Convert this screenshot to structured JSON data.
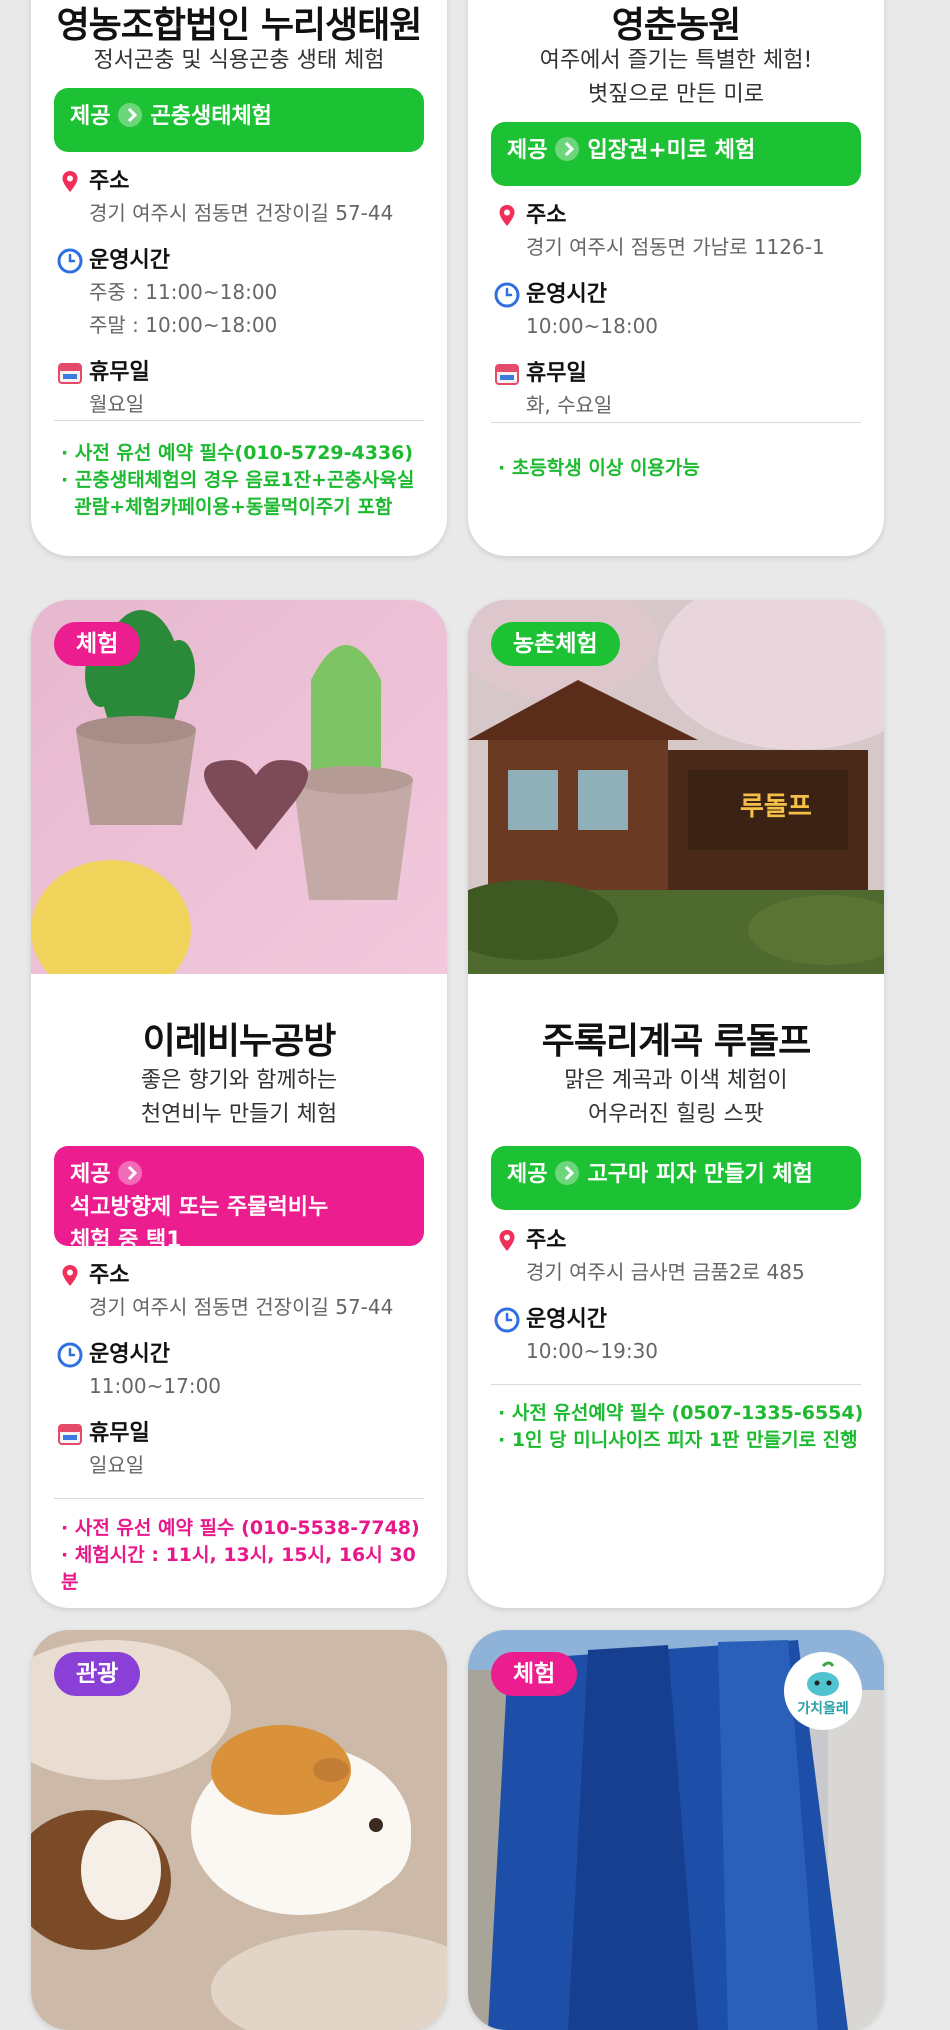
{
  "colors": {
    "green": "#1dc234",
    "pink": "#ec1d8f",
    "purple": "#8a3fd6"
  },
  "cards": [
    {
      "title": "영농조합법인 누리생태원",
      "subtitle": [
        "정서곤충 및 식용곤충 생태 체험"
      ],
      "provide_label": "제공",
      "provide_text": "곤충생태체험",
      "address_label": "주소",
      "address": "경기 여주시 점동면 건장이길 57-44",
      "hours_label": "운영시간",
      "hours": [
        "주중 : 11:00~18:00",
        "주말 : 10:00~18:00"
      ],
      "closed_label": "휴무일",
      "closed": "월요일",
      "notes": [
        "· 사전 유선 예약 필수(010-5729-4336)",
        "· 곤충생태체험의 경우 음료1잔+곤충사육실",
        "  관람+체험카페이용+동물먹이주기 포함"
      ]
    },
    {
      "title": "영춘농원",
      "subtitle": [
        "여주에서 즐기는 특별한 체험!",
        "볏짚으로 만든 미로"
      ],
      "provide_label": "제공",
      "provide_text": "입장권+미로 체험",
      "address_label": "주소",
      "address": "경기 여주시 점동면 가남로 1126-1",
      "hours_label": "운영시간",
      "hours": [
        "10:00~18:00"
      ],
      "closed_label": "휴무일",
      "closed": "화, 수요일",
      "notes": [
        "· 초등학생 이상 이용가능"
      ]
    },
    {
      "badge": "체험",
      "title": "이레비누공방",
      "subtitle": [
        "좋은 향기와 함께하는",
        "천연비누 만들기 체험"
      ],
      "provide_label": "제공",
      "provide_text": [
        "석고방향제 또는 주물럭비누",
        "체험 중 택1"
      ],
      "address_label": "주소",
      "address": "경기 여주시 점동면 건장이길 57-44",
      "hours_label": "운영시간",
      "hours": [
        "11:00~17:00"
      ],
      "closed_label": "휴무일",
      "closed": "일요일",
      "notes": [
        "· 사전 유선 예약 필수 (010-5538-7748)",
        "· 체험시간 : 11시, 13시, 15시, 16시 30분"
      ]
    },
    {
      "badge": "농촌체험",
      "photo_sign": "루돌프",
      "title": "주록리계곡 루돌프",
      "subtitle": [
        "맑은 계곡과 이색 체험이",
        "어우러진 힐링 스팟"
      ],
      "provide_label": "제공",
      "provide_text": "고구마 피자 만들기 체험",
      "address_label": "주소",
      "address": "경기 여주시 금사면 금품2로 485",
      "hours_label": "운영시간",
      "hours": [
        "10:00~19:30"
      ],
      "notes": [
        "· 사전 유선예약 필수 (0507-1335-6554)",
        "· 1인 당 미니사이즈 피자 1판 만들기로 진행"
      ]
    },
    {
      "badge": "관광"
    },
    {
      "badge": "체험",
      "logo_text": "가치올레"
    }
  ]
}
